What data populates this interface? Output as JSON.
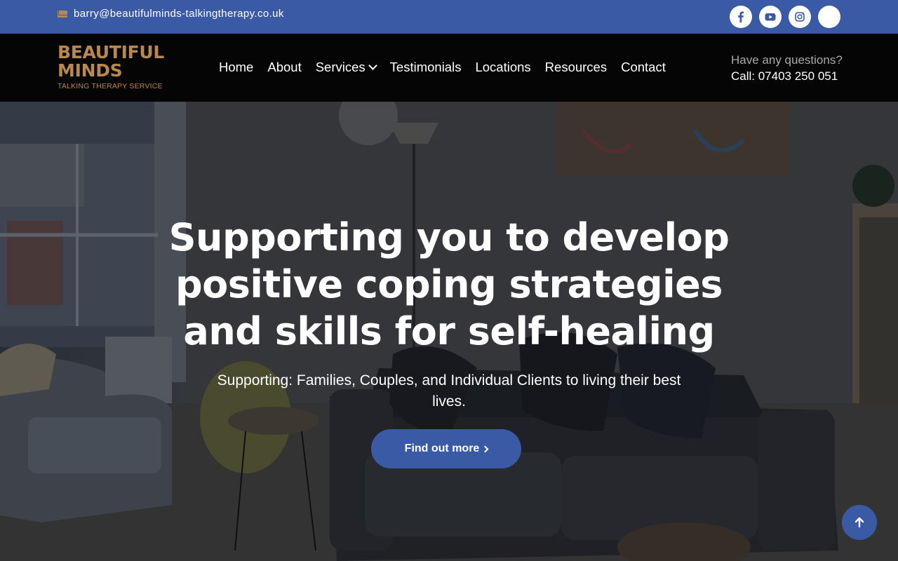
{
  "topbar": {
    "email": "barry@beautifulminds-talkingtherapy.co.uk",
    "socials": [
      {
        "icon": "facebook-icon"
      },
      {
        "icon": "youtube-icon"
      },
      {
        "icon": "instagram-icon"
      },
      {
        "icon": "blank-social-icon"
      }
    ]
  },
  "logo": {
    "line1": "BEAUTIFUL",
    "line2": "MINDS",
    "line3": "TALKING THERAPY SERVICE"
  },
  "nav": {
    "home": "Home",
    "about": "About",
    "services": "Services",
    "testimonials": "Testimonials",
    "locations": "Locations",
    "resources": "Resources",
    "contact": "Contact"
  },
  "contact": {
    "question": "Have any questions?",
    "call": "Call: 07403 250 051"
  },
  "hero": {
    "title": "Supporting you to develop positive coping strategies and skills for self-healing",
    "subtitle": "Supporting: Families, Couples, and Individual Clients to living their best lives.",
    "cta": "Find out more"
  },
  "colors": {
    "primary": "#3b5aa5",
    "logo_gold": "#b9884d",
    "nav_bg": "#050505"
  }
}
